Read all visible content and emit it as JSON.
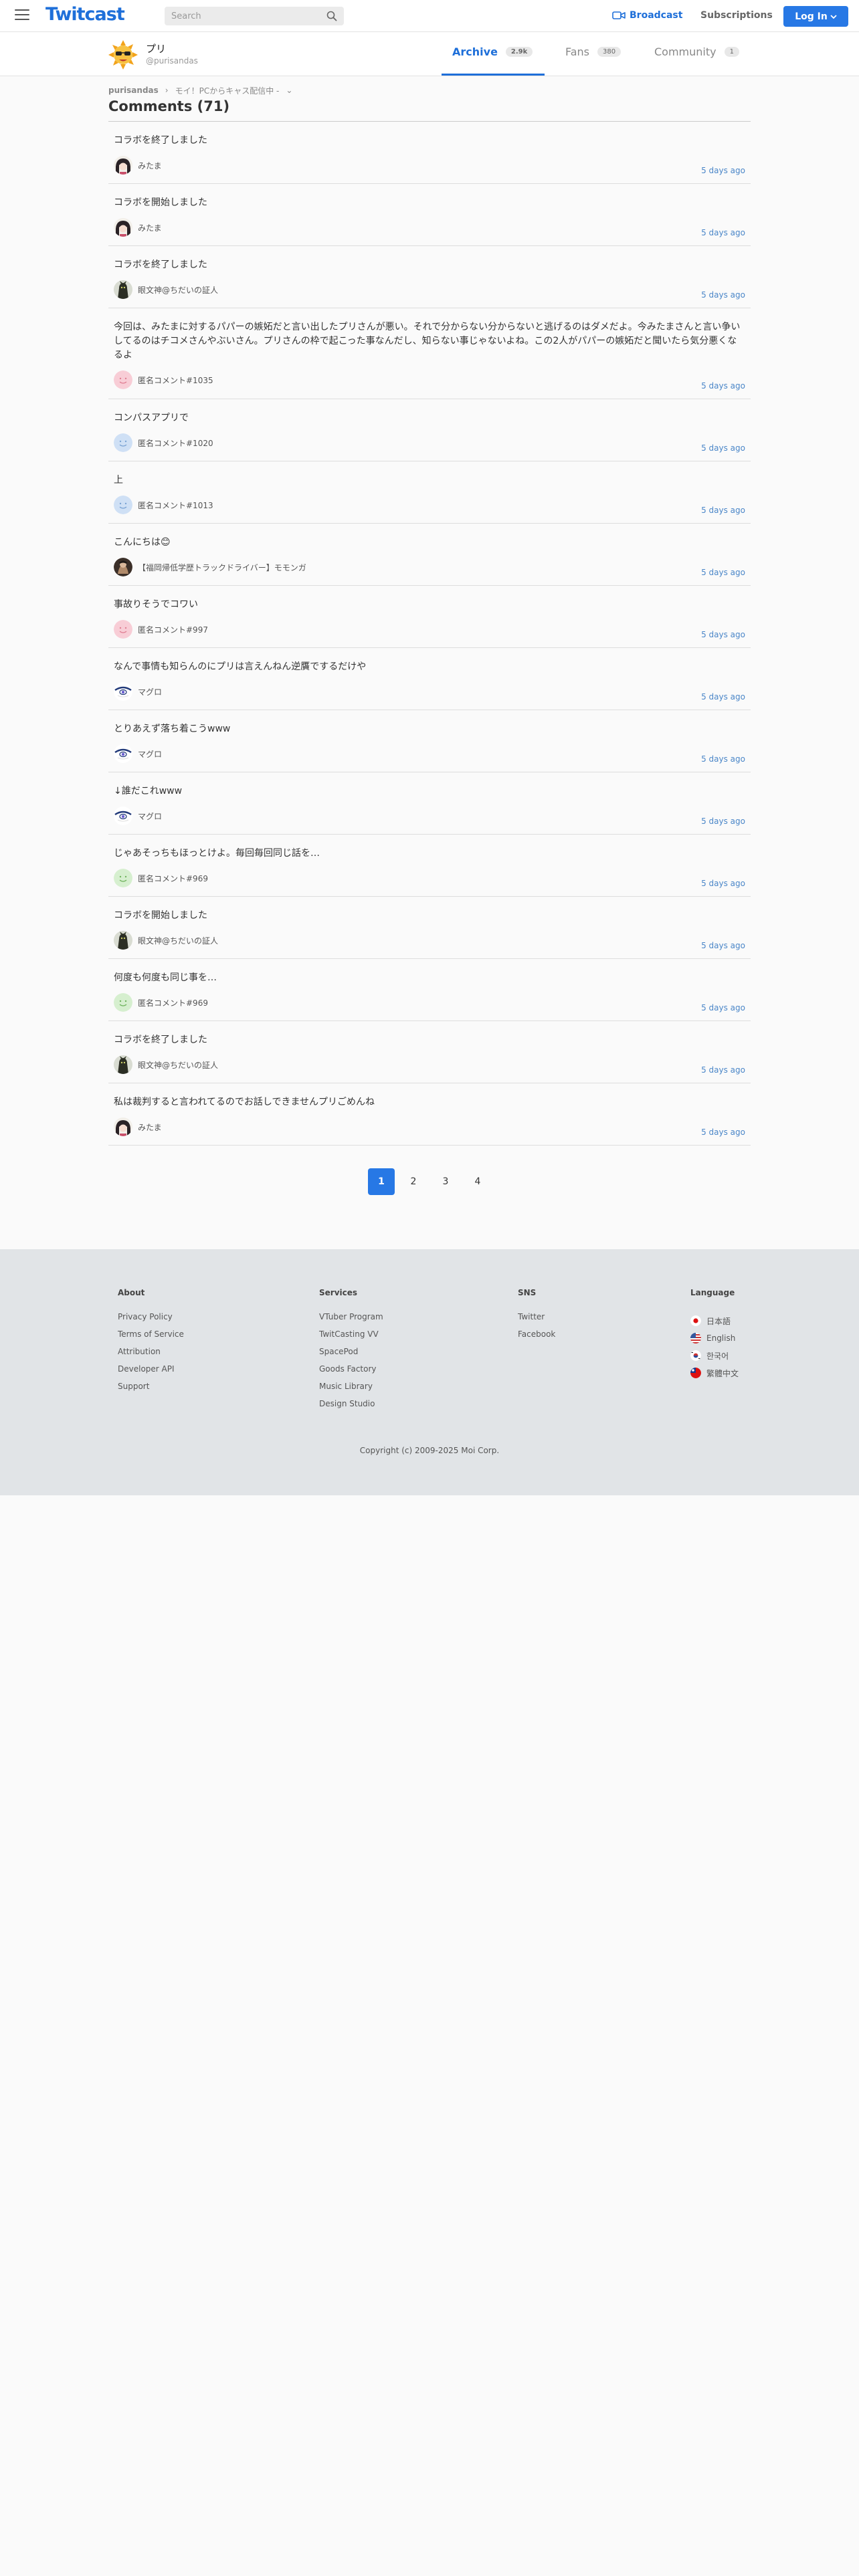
{
  "header": {
    "logo": "Twitcast",
    "search_placeholder": "Search",
    "broadcast": "Broadcast",
    "subscriptions": "Subscriptions",
    "login": "Log In"
  },
  "profile": {
    "name": "プリ",
    "handle": "@purisandas",
    "tabs": [
      {
        "label": "Archive",
        "count": "2.9k"
      },
      {
        "label": "Fans",
        "count": "380"
      },
      {
        "label": "Community",
        "count": "1"
      }
    ]
  },
  "breadcrumb": {
    "user": "purisandas",
    "movie": "モイ！PCからキャス配信中 -"
  },
  "comments_title": "Comments (71)",
  "comments": [
    {
      "text": "コラボを終了しました",
      "user": "みたま",
      "avatar": "mitama",
      "time": "5 days ago"
    },
    {
      "text": "コラボを開始しました",
      "user": "みたま",
      "avatar": "mitama",
      "time": "5 days ago"
    },
    {
      "text": "コラボを終了しました",
      "user": "眼文神@ちだいの証人",
      "avatar": "dark",
      "time": "5 days ago"
    },
    {
      "text": "今回は、みたまに対するパパーの嫉妬だと言い出したプリさんが悪い。それで分からない分からないと逃げるのはダメだよ。今みたまさんと言い争いしてるのはチコメさんやぶいさん。プリさんの枠で起こった事なんだし、知らない事じゃないよね。この2人がパパーの嫉妬だと聞いたら気分悪くなるよ",
      "user": "匿名コメント#1035",
      "avatar": "pink",
      "time": "5 days ago"
    },
    {
      "text": "コンパスアプリで",
      "user": "匿名コメント#1020",
      "avatar": "blue",
      "time": "5 days ago"
    },
    {
      "text": "上",
      "user": "匿名コメント#1013",
      "avatar": "blue",
      "time": "5 days ago"
    },
    {
      "text": "こんにちは😊",
      "user": "【福岡帰低学歴トラックドライバー】モモンガ",
      "avatar": "momonga",
      "time": "5 days ago"
    },
    {
      "text": "事故りそうでコワい",
      "user": "匿名コメント#997",
      "avatar": "pink",
      "time": "5 days ago"
    },
    {
      "text": "なんで事情も知らんのにプリは言えんねん逆贋でするだけや",
      "user": "マグロ",
      "avatar": "maguro",
      "time": "5 days ago"
    },
    {
      "text": "とりあえず落ち着こうwww",
      "user": "マグロ",
      "avatar": "maguro",
      "time": "5 days ago"
    },
    {
      "text": "↓誰だこれwww",
      "user": "マグロ",
      "avatar": "maguro",
      "time": "5 days ago"
    },
    {
      "text": "じゃあそっちもほっとけよ。毎回毎回同じ話を…",
      "user": "匿名コメント#969",
      "avatar": "green",
      "time": "5 days ago"
    },
    {
      "text": "コラボを開始しました",
      "user": "眼文神@ちだいの証人",
      "avatar": "dark",
      "time": "5 days ago"
    },
    {
      "text": "何度も何度も同じ事を…",
      "user": "匿名コメント#969",
      "avatar": "green",
      "time": "5 days ago"
    },
    {
      "text": "コラボを終了しました",
      "user": "眼文神@ちだいの証人",
      "avatar": "dark",
      "time": "5 days ago"
    },
    {
      "text": "私は裁判すると言われてるのでお話しできませんプリごめんね",
      "user": "みたま",
      "avatar": "mitama",
      "time": "5 days ago"
    }
  ],
  "pagination": [
    "1",
    "2",
    "3",
    "4"
  ],
  "footer": {
    "about": {
      "title": "About",
      "links": [
        "Privacy Policy",
        "Terms of Service",
        "Attribution",
        "Developer API",
        "Support"
      ]
    },
    "services": {
      "title": "Services",
      "links": [
        "VTuber Program",
        "TwitCasting VV",
        "SpacePod",
        "Goods Factory",
        "Music Library",
        "Design Studio"
      ]
    },
    "sns": {
      "title": "SNS",
      "links": [
        "Twitter",
        "Facebook"
      ]
    },
    "language": {
      "title": "Language",
      "links": [
        "日本語",
        "English",
        "한국어",
        "繁體中文"
      ]
    },
    "copyright": "Copyright (c) 2009-2025 Moi Corp."
  },
  "colors": {
    "accent": "#2778e5",
    "link": "#4a86c8",
    "footer_bg": "#e1e4e7"
  }
}
